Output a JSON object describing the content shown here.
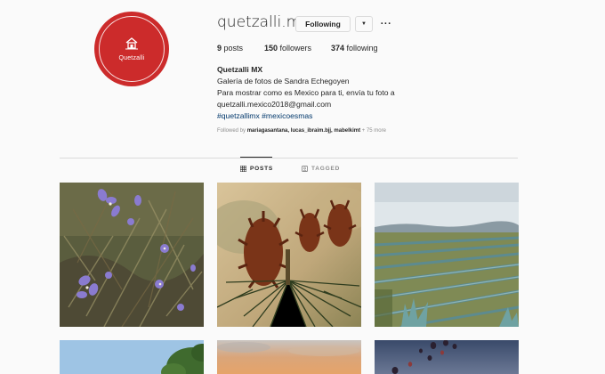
{
  "profile": {
    "username": "quetzalli.mx",
    "avatar_text": "Quetzalli",
    "following_label": "Following",
    "more_label": "···",
    "dropdown_icon": "chevron-down-icon",
    "brand_color": "#cc2b2b"
  },
  "stats": {
    "posts_count": "9",
    "posts_label": "posts",
    "followers_count": "150",
    "followers_label": "followers",
    "following_count": "374",
    "following_label": "following"
  },
  "bio": {
    "name": "Quetzalli MX",
    "line1": "Galería de fotos de Sandra Echegoyen",
    "line2": "Para mostrar como es Mexico para ti, envía tu foto a",
    "line3": "quetzalli.mexico2018@gmail.com",
    "hashtags": "#quetzallimx #mexicoesmas"
  },
  "followed_by": {
    "prefix": "Followed by",
    "users": "mariagasantana, lucas_ibraim.bjj, mabelkimt",
    "more": "+ 75 more"
  },
  "tabs": {
    "posts": "POSTS",
    "tagged": "TAGGED"
  },
  "grid": [
    {
      "subject": "purple wildflowers"
    },
    {
      "subject": "pine cones"
    },
    {
      "subject": "agave field"
    },
    {
      "subject": "trees and sky"
    },
    {
      "subject": "sunset sky"
    },
    {
      "subject": "hot air balloons"
    }
  ]
}
